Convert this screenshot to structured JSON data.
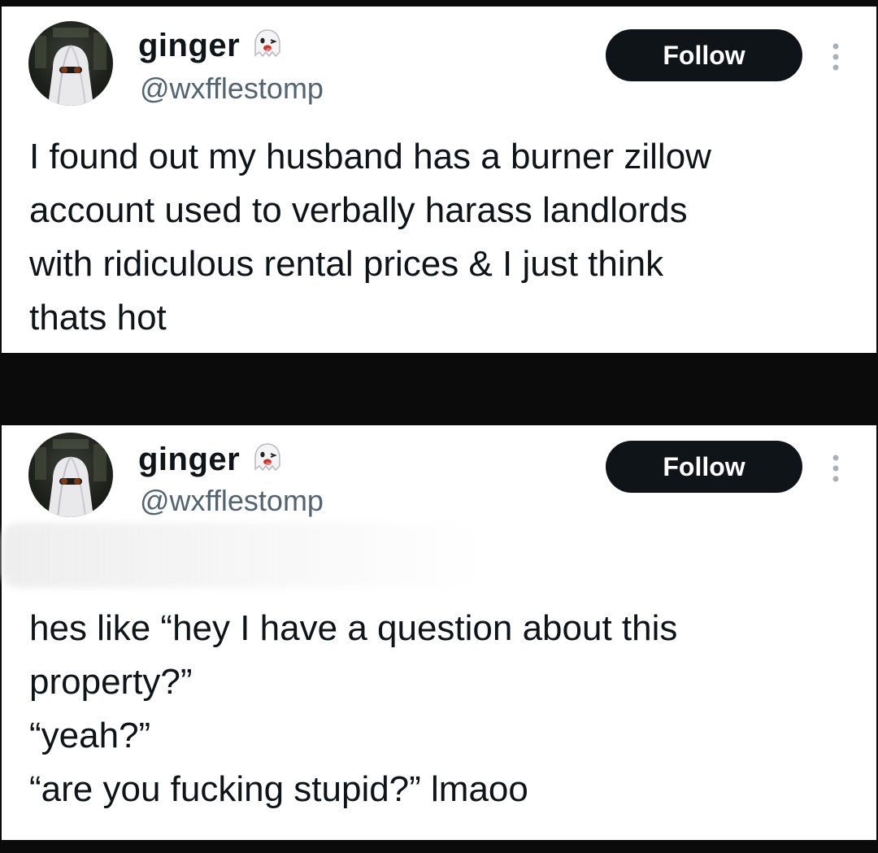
{
  "posts": [
    {
      "author": {
        "display_name": "ginger",
        "handle": "@wxfflestomp",
        "badge_icon": "ghost-emoji-icon"
      },
      "follow_label": "Follow",
      "more_icon": "more-vertical-icon",
      "text": "I found out my husband has a burner zillow\naccount used to verbally harass landlords\nwith ridiculous rental prices & I just think\nthats hot"
    },
    {
      "author": {
        "display_name": "ginger",
        "handle": "@wxfflestomp",
        "badge_icon": "ghost-emoji-icon"
      },
      "follow_label": "Follow",
      "more_icon": "more-vertical-icon",
      "text": "hes like “hey I have a question about this\nproperty?”\n“yeah?”\n“are you fucking stupid?” lmaoo"
    }
  ],
  "colors": {
    "background": "#0b0b0b",
    "card": "#ffffff",
    "text_primary": "#0f1419",
    "text_secondary": "#536471",
    "button": "#0f1419"
  }
}
